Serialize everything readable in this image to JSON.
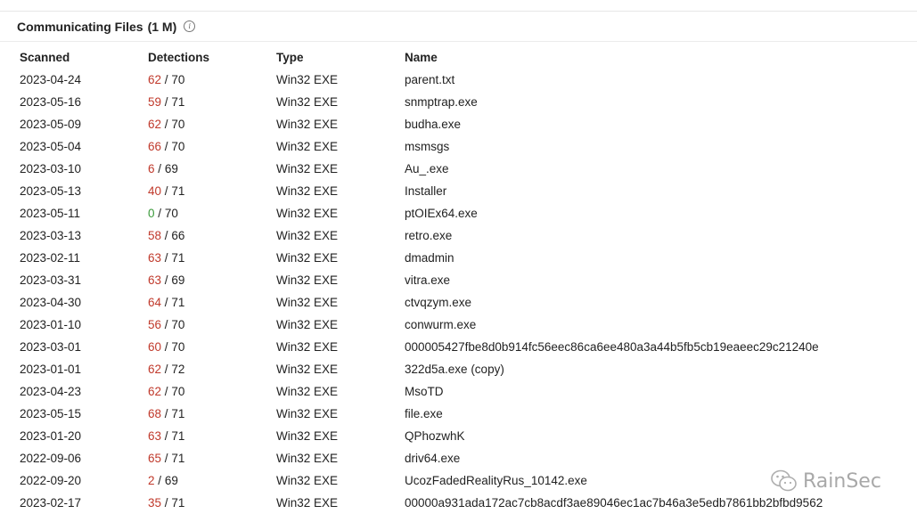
{
  "header": {
    "title": "Communicating Files",
    "count": "(1 M)"
  },
  "columns": {
    "scanned": "Scanned",
    "detections": "Detections",
    "type": "Type",
    "name": "Name"
  },
  "rows": [
    {
      "scanned": "2023-04-24",
      "det": "62",
      "total": "70",
      "type": "Win32 EXE",
      "name": "parent.txt"
    },
    {
      "scanned": "2023-05-16",
      "det": "59",
      "total": "71",
      "type": "Win32 EXE",
      "name": "snmptrap.exe"
    },
    {
      "scanned": "2023-05-09",
      "det": "62",
      "total": "70",
      "type": "Win32 EXE",
      "name": "budha.exe"
    },
    {
      "scanned": "2023-05-04",
      "det": "66",
      "total": "70",
      "type": "Win32 EXE",
      "name": "msmsgs"
    },
    {
      "scanned": "2023-03-10",
      "det": "6",
      "total": "69",
      "type": "Win32 EXE",
      "name": "Au_.exe"
    },
    {
      "scanned": "2023-05-13",
      "det": "40",
      "total": "71",
      "type": "Win32 EXE",
      "name": "Installer"
    },
    {
      "scanned": "2023-05-11",
      "det": "0",
      "total": "70",
      "type": "Win32 EXE",
      "name": "ptOIEx64.exe"
    },
    {
      "scanned": "2023-03-13",
      "det": "58",
      "total": "66",
      "type": "Win32 EXE",
      "name": "retro.exe"
    },
    {
      "scanned": "2023-02-11",
      "det": "63",
      "total": "71",
      "type": "Win32 EXE",
      "name": "dmadmin"
    },
    {
      "scanned": "2023-03-31",
      "det": "63",
      "total": "69",
      "type": "Win32 EXE",
      "name": "vitra.exe"
    },
    {
      "scanned": "2023-04-30",
      "det": "64",
      "total": "71",
      "type": "Win32 EXE",
      "name": "ctvqzym.exe"
    },
    {
      "scanned": "2023-01-10",
      "det": "56",
      "total": "70",
      "type": "Win32 EXE",
      "name": "conwurm.exe"
    },
    {
      "scanned": "2023-03-01",
      "det": "60",
      "total": "70",
      "type": "Win32 EXE",
      "name": "000005427fbe8d0b914fc56eec86ca6ee480a3a44b5fb5cb19eaeec29c21240e"
    },
    {
      "scanned": "2023-01-01",
      "det": "62",
      "total": "72",
      "type": "Win32 EXE",
      "name": "322d5a.exe (copy)"
    },
    {
      "scanned": "2023-04-23",
      "det": "62",
      "total": "70",
      "type": "Win32 EXE",
      "name": "MsoTD"
    },
    {
      "scanned": "2023-05-15",
      "det": "68",
      "total": "71",
      "type": "Win32 EXE",
      "name": "file.exe"
    },
    {
      "scanned": "2023-01-20",
      "det": "63",
      "total": "71",
      "type": "Win32 EXE",
      "name": "QPhozwhK"
    },
    {
      "scanned": "2022-09-06",
      "det": "65",
      "total": "71",
      "type": "Win32 EXE",
      "name": "driv64.exe"
    },
    {
      "scanned": "2022-09-20",
      "det": "2",
      "total": "69",
      "type": "Win32 EXE",
      "name": "UcozFadedRealityRus_10142.exe"
    },
    {
      "scanned": "2023-02-17",
      "det": "35",
      "total": "71",
      "type": "Win32 EXE",
      "name": "00000a931ada172ac7cb8acdf3ae89046ec1ac7b46a3e5edb7861bb2bfbd9562"
    }
  ],
  "separator": "/",
  "watermark": {
    "text": "RainSec",
    "icon": "wechat-icon"
  },
  "colors": {
    "detected": "#c0392b",
    "clean": "#3a9a3a"
  }
}
